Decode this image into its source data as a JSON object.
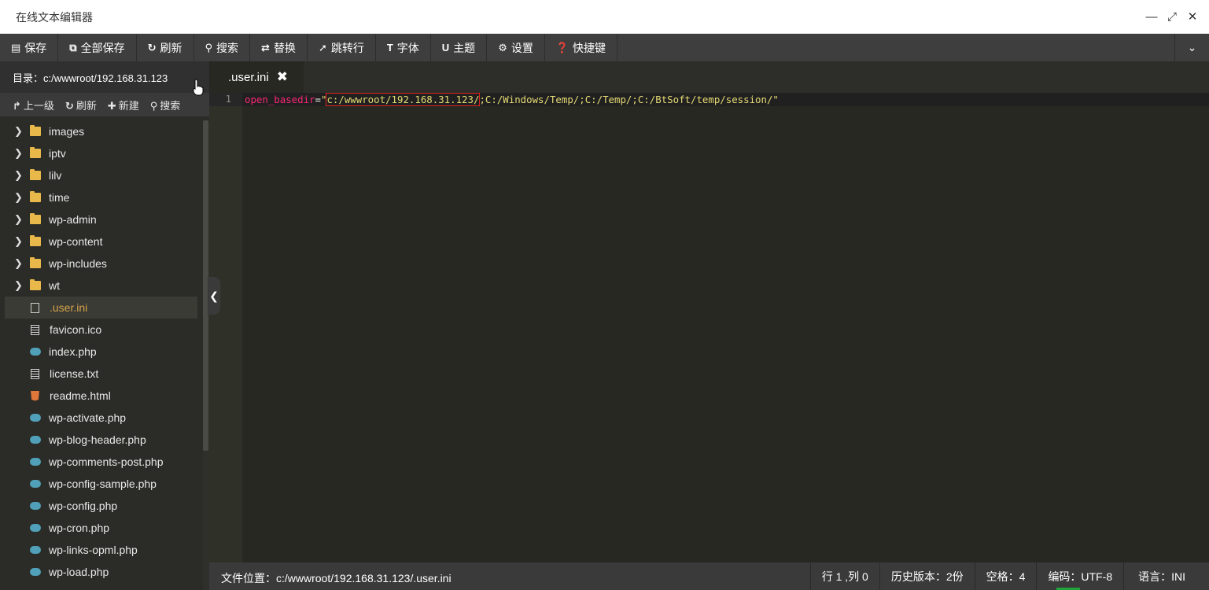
{
  "window": {
    "title": "在线文本编辑器",
    "controls": [
      "minimize-icon",
      "maximize-icon",
      "close-icon"
    ]
  },
  "toolbar": {
    "buttons": [
      {
        "label": "保存",
        "icon": "save-icon",
        "glyph": "💾"
      },
      {
        "label": "全部保存",
        "icon": "save-all-icon",
        "glyph": "⎘"
      },
      {
        "label": "刷新",
        "icon": "refresh-icon",
        "glyph": "↻"
      },
      {
        "label": "搜索",
        "icon": "search-icon",
        "glyph": "🔍"
      },
      {
        "label": "替换",
        "icon": "replace-icon",
        "glyph": "⇄"
      },
      {
        "label": "跳转行",
        "icon": "pin-icon",
        "glyph": "📌"
      },
      {
        "label": "字体",
        "icon": "font-icon",
        "glyph": "T"
      },
      {
        "label": "主题",
        "icon": "magnet-icon",
        "glyph": "U"
      },
      {
        "label": "设置",
        "icon": "gear-icon",
        "glyph": "⚙"
      },
      {
        "label": "快捷键",
        "icon": "help-icon",
        "glyph": "?"
      }
    ]
  },
  "sidebar": {
    "dir_label": "目录：c:/wwwroot/192.168.31.123",
    "actions": [
      {
        "label": "上一级",
        "icon": "share-icon",
        "glyph": "↱"
      },
      {
        "label": "刷新",
        "icon": "refresh-icon",
        "glyph": "↻"
      },
      {
        "label": "新建",
        "icon": "plus-icon",
        "glyph": "✚"
      },
      {
        "label": "搜索",
        "icon": "search-icon",
        "glyph": "⌕"
      }
    ],
    "items": [
      {
        "name": "images",
        "type": "folder"
      },
      {
        "name": "iptv",
        "type": "folder"
      },
      {
        "name": "lilv",
        "type": "folder"
      },
      {
        "name": "time",
        "type": "folder"
      },
      {
        "name": "wp-admin",
        "type": "folder"
      },
      {
        "name": "wp-content",
        "type": "folder"
      },
      {
        "name": "wp-includes",
        "type": "folder"
      },
      {
        "name": "wt",
        "type": "folder"
      },
      {
        "name": ".user.ini",
        "type": "file",
        "active": true
      },
      {
        "name": "favicon.ico",
        "type": "text"
      },
      {
        "name": "index.php",
        "type": "php"
      },
      {
        "name": "license.txt",
        "type": "text"
      },
      {
        "name": "readme.html",
        "type": "html"
      },
      {
        "name": "wp-activate.php",
        "type": "php"
      },
      {
        "name": "wp-blog-header.php",
        "type": "php"
      },
      {
        "name": "wp-comments-post.php",
        "type": "php"
      },
      {
        "name": "wp-config-sample.php",
        "type": "php"
      },
      {
        "name": "wp-config.php",
        "type": "php"
      },
      {
        "name": "wp-cron.php",
        "type": "php"
      },
      {
        "name": "wp-links-opml.php",
        "type": "php"
      },
      {
        "name": "wp-load.php",
        "type": "php"
      }
    ]
  },
  "tabs": [
    {
      "label": ".user.ini",
      "close_glyph": "✖"
    }
  ],
  "editor": {
    "line_number": "1",
    "key": "open_basedir",
    "eq": "=",
    "quote_open": "\"",
    "highlighted_path": "c:/wwwroot/192.168.31.123/",
    "rest": ";C:/Windows/Temp/;C:/Temp/;C:/BtSoft/temp/session/\""
  },
  "status": {
    "path": "文件位置：c:/wwwroot/192.168.31.123/.user.ini",
    "cursor": "行 1 ,列 0",
    "history": "历史版本：2份",
    "indent": "空格：4",
    "encoding": "编码：UTF-8",
    "language": "语言：INI"
  },
  "colors": {
    "accent": "#20a53a",
    "toolbar": "#3e3e3e",
    "editor_bg": "#272822",
    "active_file": "#d7a34b",
    "highlight_box": "#e02020"
  }
}
